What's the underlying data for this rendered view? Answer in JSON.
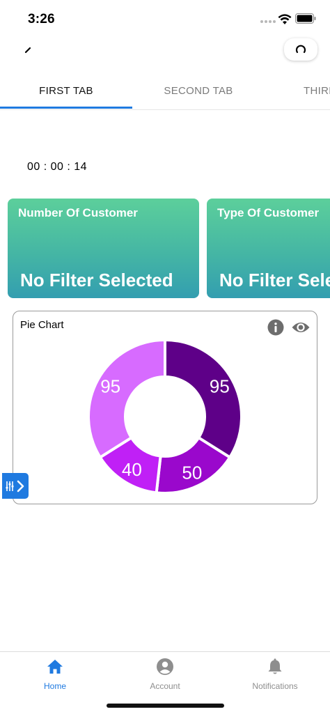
{
  "status_bar": {
    "time": "3:26"
  },
  "tabs": [
    {
      "label": "FIRST TAB",
      "active": true
    },
    {
      "label": "SECOND TAB",
      "active": false
    },
    {
      "label": "THIRD TAB",
      "active": false
    }
  ],
  "timer": "00 : 00 : 14",
  "cards": [
    {
      "title": "Number Of Customer",
      "value": "No Filter Selected"
    },
    {
      "title": "Type Of Customer",
      "value": "No Filter Selected"
    }
  ],
  "chart_panel": {
    "title": "Pie Chart",
    "icons": [
      "info-icon",
      "eye-icon"
    ]
  },
  "chart_data": {
    "type": "pie",
    "title": "Pie Chart",
    "values": [
      95,
      50,
      40,
      95
    ],
    "colors": [
      "#5e0088",
      "#9a08cc",
      "#c020f6",
      "#d76bff"
    ],
    "labels": [
      "95",
      "50",
      "40",
      "95"
    ]
  },
  "bottom_nav": [
    {
      "label": "Home",
      "icon": "home-icon",
      "active": true
    },
    {
      "label": "Account",
      "icon": "account-icon",
      "active": false
    },
    {
      "label": "Notifications",
      "icon": "bell-icon",
      "active": false
    }
  ],
  "colors": {
    "accent": "#1f7ae0",
    "card_gradient_top": "#5ccf9b",
    "card_gradient_bottom": "#339eb0"
  }
}
